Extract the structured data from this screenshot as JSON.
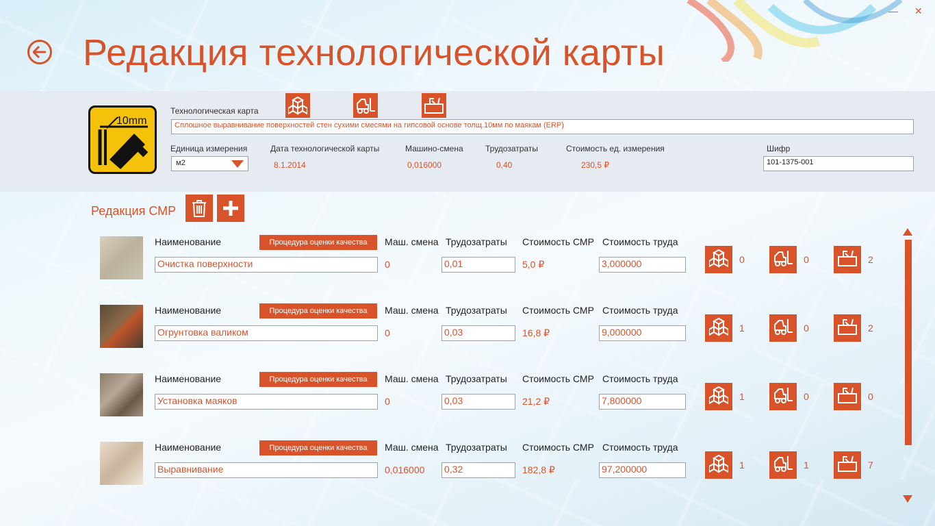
{
  "page": {
    "title": "Редакция технологической карты",
    "colors": {
      "accent": "#d9532a",
      "panel": "#e6eaf1",
      "logo_bg": "#f5c20a"
    }
  },
  "window": {
    "minimize_label": "—",
    "close_label": "✕"
  },
  "card": {
    "logo_text": "10mm",
    "label": "Технологическая карта",
    "name": "Сплошное выравнивание поверхностей стен сухими смесями на гипсовой основе толщ.10мм по маякам (ERP)",
    "unit_label": "Единица измерения",
    "unit_value": "м2",
    "date_label": "Дата технологической карты",
    "date_value": "8.1.2014",
    "machine_label": "Машино-смена",
    "machine_value": "0,016000",
    "labor_label": "Трудозатраты",
    "labor_value": "0,40",
    "cost_label": "Стоимость ед. измерения",
    "cost_value": "230,5 ₽",
    "code_label": "Шифр",
    "code_value": "101-1375-001"
  },
  "smr": {
    "title": "Редакция СМР",
    "col_name": "Наименование",
    "qa_label": "Процедура оценки качества",
    "col_machine": "Маш. смена",
    "col_labor": "Трудозатраты",
    "col_cost": "Стоимость СМР",
    "col_labor_cost": "Стоимость труда",
    "rows": [
      {
        "name": "Очистка поверхности",
        "machine": "0",
        "labor": "0,01",
        "cost": "5,0 ₽",
        "labor_cost": "3,000000",
        "materials": "0",
        "machinery": "0",
        "tools": "2"
      },
      {
        "name": "Огрунтовка валиком",
        "machine": "0",
        "labor": "0,03",
        "cost": "16,8 ₽",
        "labor_cost": "9,000000",
        "materials": "1",
        "machinery": "0",
        "tools": "2"
      },
      {
        "name": "Установка маяков",
        "machine": "0",
        "labor": "0,03",
        "cost": "21,2 ₽",
        "labor_cost": "7,800000",
        "materials": "1",
        "machinery": "0",
        "tools": "0"
      },
      {
        "name": "Выравнивание",
        "machine": "0,016000",
        "labor": "0,32",
        "cost": "182,8 ₽",
        "labor_cost": "97,200000",
        "materials": "1",
        "machinery": "1",
        "tools": "7"
      }
    ]
  }
}
